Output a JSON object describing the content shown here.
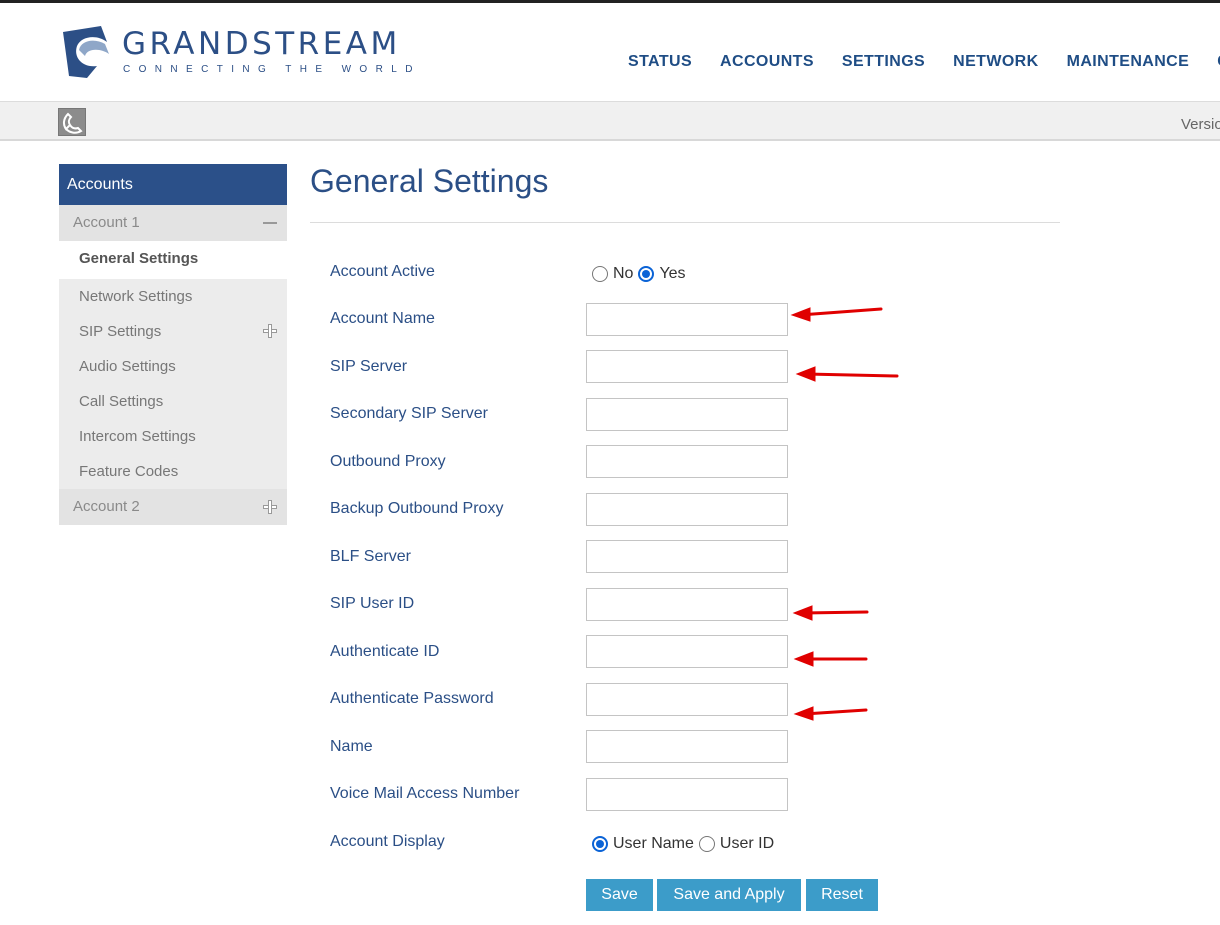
{
  "brand": {
    "name": "GRANDSTREAM",
    "tagline": "CONNECTING THE WORLD",
    "color": "#2c4f86"
  },
  "topnav": [
    "STATUS",
    "ACCOUNTS",
    "SETTINGS",
    "NETWORK",
    "MAINTENANCE",
    "CO"
  ],
  "subbar": {
    "version_label": "Versio"
  },
  "sidebar": {
    "header": "Accounts",
    "account1": "Account 1",
    "items": [
      "General Settings",
      "Network Settings",
      "SIP Settings",
      "Audio Settings",
      "Call Settings",
      "Intercom Settings",
      "Feature Codes"
    ],
    "account2": "Account 2"
  },
  "page": {
    "title": "General Settings"
  },
  "form": {
    "account_active": {
      "label": "Account Active",
      "options": [
        "No",
        "Yes"
      ],
      "selected": "Yes"
    },
    "fields": [
      {
        "label": "Account Name",
        "value": ""
      },
      {
        "label": "SIP Server",
        "value": ""
      },
      {
        "label": "Secondary SIP Server",
        "value": ""
      },
      {
        "label": "Outbound Proxy",
        "value": ""
      },
      {
        "label": "Backup Outbound Proxy",
        "value": ""
      },
      {
        "label": "BLF Server",
        "value": ""
      },
      {
        "label": "SIP User ID",
        "value": ""
      },
      {
        "label": "Authenticate ID",
        "value": ""
      },
      {
        "label": "Authenticate Password",
        "value": ""
      },
      {
        "label": "Name",
        "value": ""
      },
      {
        "label": "Voice Mail Access Number",
        "value": ""
      }
    ],
    "account_display": {
      "label": "Account Display",
      "options": [
        "User Name",
        "User ID"
      ],
      "selected": "User Name"
    }
  },
  "buttons": {
    "save": "Save",
    "save_apply": "Save and Apply",
    "reset": "Reset"
  },
  "colors": {
    "nav_text": "#1f4d85",
    "sidebar_header": "#2b5089",
    "button": "#3c9cc9",
    "annotation_arrow": "#e00000"
  }
}
